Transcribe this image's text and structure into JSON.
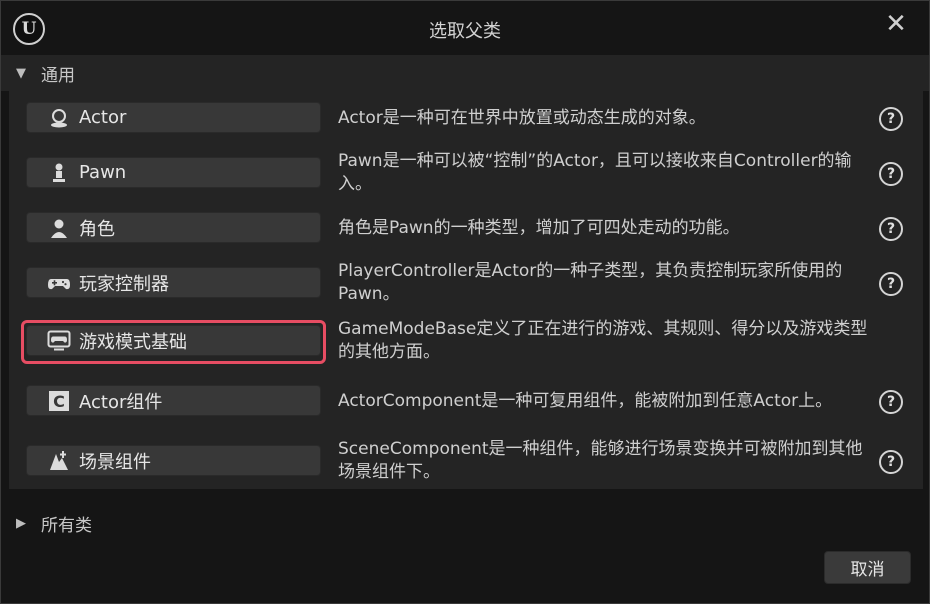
{
  "window": {
    "title": "选取父类",
    "logo_text": "U",
    "close_glyph": "✕"
  },
  "sections": {
    "common": {
      "label": "通用",
      "expanded": true
    },
    "all": {
      "label": "所有类",
      "expanded": false
    }
  },
  "classes": [
    {
      "label": "Actor",
      "icon": "actor-sphere-icon",
      "description": "Actor是一种可在世界中放置或动态生成的对象。"
    },
    {
      "label": "Pawn",
      "icon": "pawn-icon",
      "description": "Pawn是一种可以被“控制”的Actor，且可以接收来自Controller的输入。"
    },
    {
      "label": "角色",
      "icon": "character-icon",
      "description": "角色是Pawn的一种类型，增加了可四处走动的功能。"
    },
    {
      "label": "玩家控制器",
      "icon": "gamepad-icon",
      "description": "PlayerController是Actor的一种子类型，其负责控制玩家所使用的Pawn。"
    },
    {
      "label": "游戏模式基础",
      "icon": "game-mode-icon",
      "description": "GameModeBase定义了正在进行的游戏、其规则、得分以及游戏类型的其他方面。",
      "selected": true
    },
    {
      "label": "Actor组件",
      "icon": "component-icon",
      "description": "ActorComponent是一种可复用组件，能被附加到任意Actor上。"
    },
    {
      "label": "场景组件",
      "icon": "scene-component-icon",
      "description": "SceneComponent是一种组件，能够进行场景变换并可被附加到其他场景组件下。"
    }
  ],
  "help_glyph": "?",
  "footer": {
    "cancel_label": "取消"
  },
  "colors": {
    "highlight": "#e74d63",
    "panel": "#242424",
    "background": "#151515",
    "button": "#383838"
  }
}
